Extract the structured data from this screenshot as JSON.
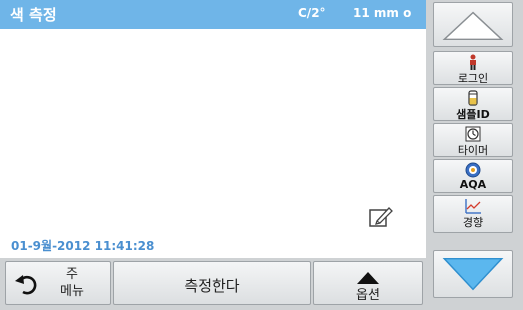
{
  "title_bar": {
    "title": "색 측정",
    "unit": "C/2°",
    "path_length": "11 mm o"
  },
  "work_area": {
    "timestamp": "01-9월-2012 11:41:28",
    "note_icon": "edit-note-icon"
  },
  "bottom_bar": {
    "main_menu_label": "주\n메뉴",
    "main_menu_icon": "return-arrow-icon",
    "measure_label": "측정한다",
    "options_label": "옵션",
    "options_icon": "triangle-up-icon"
  },
  "side_panel": {
    "scroll_up_icon": "triangle-up-icon",
    "scroll_down_icon": "triangle-down-icon",
    "login_label": "로그인",
    "sample_id_label": "샘플ID",
    "timer_label": "타이머",
    "aqa_label": "AQA",
    "trend_label": "경향"
  },
  "colors": {
    "title_bar": "#6fb5e8",
    "timestamp": "#4a8fd0",
    "panel_background": "#cfd2d4",
    "scroll_arrow": "#5bb7ee"
  }
}
